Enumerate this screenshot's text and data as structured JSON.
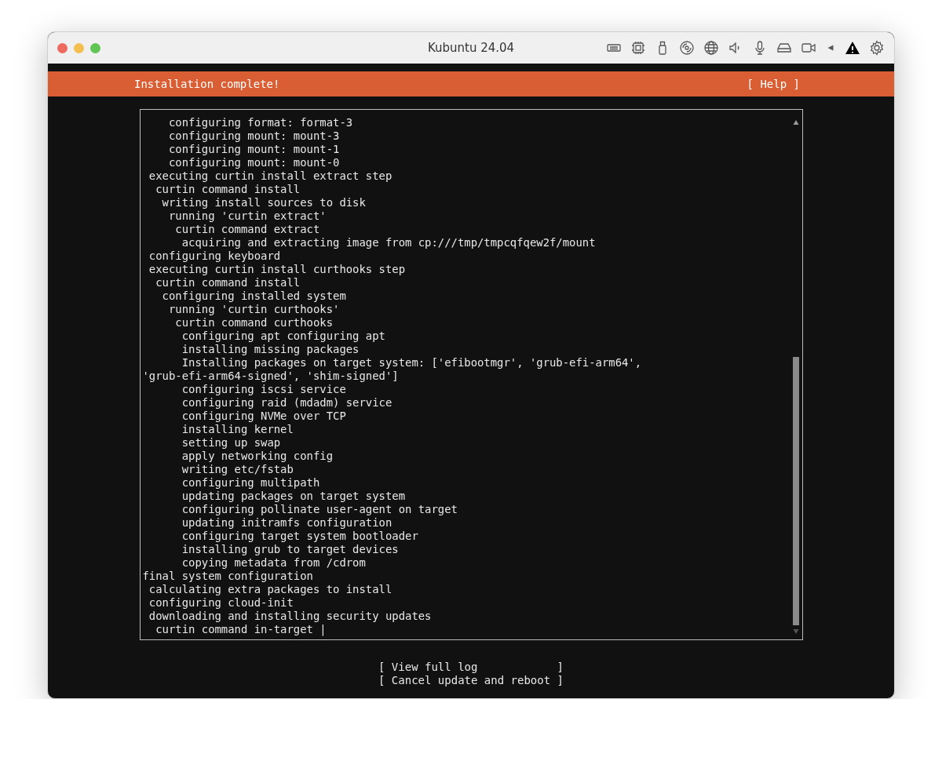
{
  "window": {
    "title": "Kubuntu 24.04"
  },
  "header": {
    "title": "Installation complete!",
    "help": "[ Help ]"
  },
  "log": {
    "lines": [
      "    configuring format: format-3",
      "    configuring mount: mount-3",
      "    configuring mount: mount-1",
      "    configuring mount: mount-0",
      " executing curtin install extract step",
      "  curtin command install",
      "   writing install sources to disk",
      "    running 'curtin extract'",
      "     curtin command extract",
      "      acquiring and extracting image from cp:///tmp/tmpcqfqew2f/mount",
      " configuring keyboard",
      " executing curtin install curthooks step",
      "  curtin command install",
      "   configuring installed system",
      "    running 'curtin curthooks'",
      "     curtin command curthooks",
      "      configuring apt configuring apt",
      "      installing missing packages",
      "      Installing packages on target system: ['efibootmgr', 'grub-efi-arm64',",
      "'grub-efi-arm64-signed', 'shim-signed']",
      "      configuring iscsi service",
      "      configuring raid (mdadm) service",
      "      configuring NVMe over TCP",
      "      installing kernel",
      "      setting up swap",
      "      apply networking config",
      "      writing etc/fstab",
      "      configuring multipath",
      "      updating packages on target system",
      "      configuring pollinate user-agent on target",
      "      updating initramfs configuration",
      "      configuring target system bootloader",
      "      installing grub to target devices",
      "      copying metadata from /cdrom",
      "final system configuration",
      " calculating extra packages to install",
      " configuring cloud-init",
      " downloading and installing security updates",
      "  curtin command in-target |"
    ]
  },
  "buttons": [
    "[ View full log            ]",
    "[ Cancel update and reboot ]"
  ]
}
